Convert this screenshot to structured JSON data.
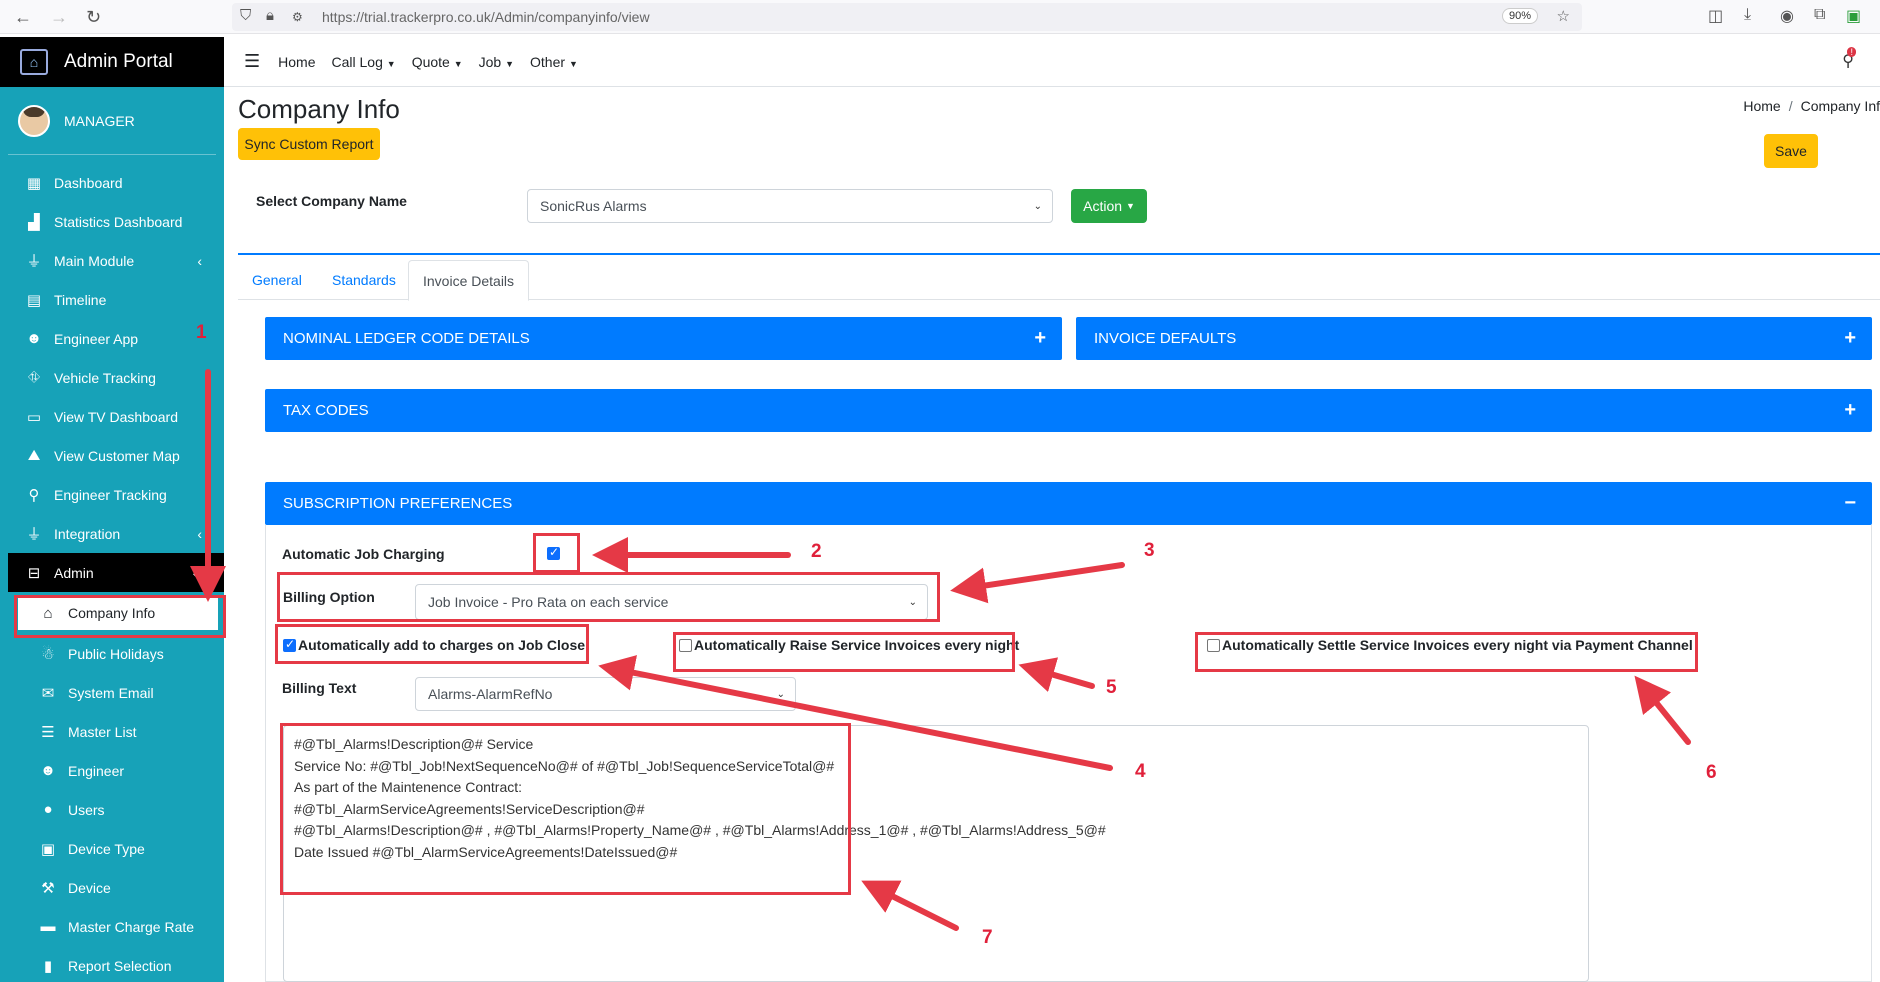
{
  "browser": {
    "url": "https://trial.trackerpro.co.uk/Admin/companyinfo/view",
    "zoom": "90%"
  },
  "sidebar": {
    "brand": "Admin Portal",
    "user": "MANAGER",
    "items": [
      {
        "label": "Dashboard",
        "icon": "grid-icon"
      },
      {
        "label": "Statistics Dashboard",
        "icon": "bar-chart-icon"
      },
      {
        "label": "Main Module",
        "icon": "plug-icon"
      },
      {
        "label": "Timeline",
        "icon": "calendar-icon"
      },
      {
        "label": "Engineer App",
        "icon": "user-gear-icon"
      },
      {
        "label": "Vehicle Tracking",
        "icon": "route-icon"
      },
      {
        "label": "View TV Dashboard",
        "icon": "monitor-icon"
      },
      {
        "label": "View Customer Map",
        "icon": "map-icon"
      },
      {
        "label": "Engineer Tracking",
        "icon": "map-pin-icon"
      },
      {
        "label": "Integration",
        "icon": "plug-icon"
      },
      {
        "label": "Admin",
        "icon": "toolbox-icon"
      },
      {
        "label": "Company Info",
        "icon": "home-icon"
      },
      {
        "label": "Public Holidays",
        "icon": "holiday-icon"
      },
      {
        "label": "System Email",
        "icon": "mail-gear-icon"
      },
      {
        "label": "Master List",
        "icon": "database-icon"
      },
      {
        "label": "Engineer",
        "icon": "user-gear-icon"
      },
      {
        "label": "Users",
        "icon": "user-icon"
      },
      {
        "label": "Device Type",
        "icon": "box-icon"
      },
      {
        "label": "Device",
        "icon": "wrench-icon"
      },
      {
        "label": "Master Charge Rate",
        "icon": "money-icon"
      },
      {
        "label": "Report Selection",
        "icon": "file-icon"
      }
    ]
  },
  "topnav": {
    "items": [
      "Home",
      "Call Log",
      "Quote",
      "Job",
      "Other"
    ]
  },
  "page": {
    "title": "Company Info",
    "breadcrumb_home": "Home",
    "breadcrumb_current": "Company Inf",
    "sync_button": "Sync Custom Report",
    "save_button": "Save",
    "select_company_label": "Select Company Name",
    "company_value": "SonicRus Alarms",
    "action_button": "Action"
  },
  "tabs": [
    "General",
    "Standards",
    "Invoice Details"
  ],
  "active_tab": "Invoice Details",
  "panels": {
    "nominal": "NOMINAL LEDGER CODE DETAILS",
    "invoice_defaults": "INVOICE DEFAULTS",
    "tax_codes": "TAX CODES",
    "subscription": "SUBSCRIPTION PREFERENCES"
  },
  "subscription": {
    "auto_job_charging_label": "Automatic Job Charging",
    "auto_job_charging": true,
    "billing_option_label": "Billing Option",
    "billing_option_value": "Job Invoice - Pro Rata on each service",
    "auto_add_charges_label": "Automatically add to charges on Job Close",
    "auto_add_charges": true,
    "auto_raise_label": "Automatically Raise Service Invoices every night",
    "auto_raise": false,
    "auto_settle_label": "Automatically Settle Service Invoices every night via Payment Channel",
    "auto_settle": false,
    "billing_text_label": "Billing Text",
    "billing_text_value": "Alarms-AlarmRefNo",
    "template_lines": [
      " #@Tbl_Alarms!Description@# Service",
      "Service  No:  #@Tbl_Job!NextSequenceNo@#  of  #@Tbl_Job!SequenceServiceTotal@#",
      "As part of the Maintenence Contract:",
      " #@Tbl_AlarmServiceAgreements!ServiceDescription@#",
      " #@Tbl_Alarms!Description@# ,  #@Tbl_Alarms!Property_Name@# , #@Tbl_Alarms!Address_1@# , #@Tbl_Alarms!Address_5@#",
      "Date Issued  #@Tbl_AlarmServiceAgreements!DateIssued@#"
    ]
  },
  "annotations": [
    "1",
    "2",
    "3",
    "4",
    "5",
    "6",
    "7"
  ],
  "colors": {
    "sidebar": "#17a2b8",
    "panel": "#007bff",
    "annotation": "#e53946",
    "warning": "#ffc107",
    "success": "#28a745"
  }
}
